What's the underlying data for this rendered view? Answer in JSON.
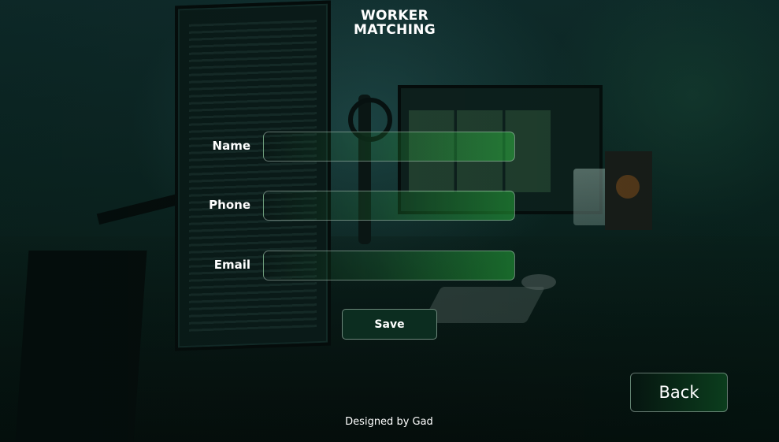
{
  "header": {
    "title_line1": "WORKER",
    "title_line2": "MATCHING"
  },
  "form": {
    "name": {
      "label": "Name",
      "value": "",
      "placeholder": ""
    },
    "phone": {
      "label": "Phone",
      "value": "",
      "placeholder": ""
    },
    "email": {
      "label": "Email",
      "value": "",
      "placeholder": ""
    },
    "save_label": "Save"
  },
  "navigation": {
    "back_label": "Back"
  },
  "footer": {
    "credit": "Designed by Gad"
  },
  "colors": {
    "background": "#0c1e1a",
    "accent_green": "#28aa3c",
    "button_dark": "#0c2d20",
    "text": "#ffffff"
  }
}
